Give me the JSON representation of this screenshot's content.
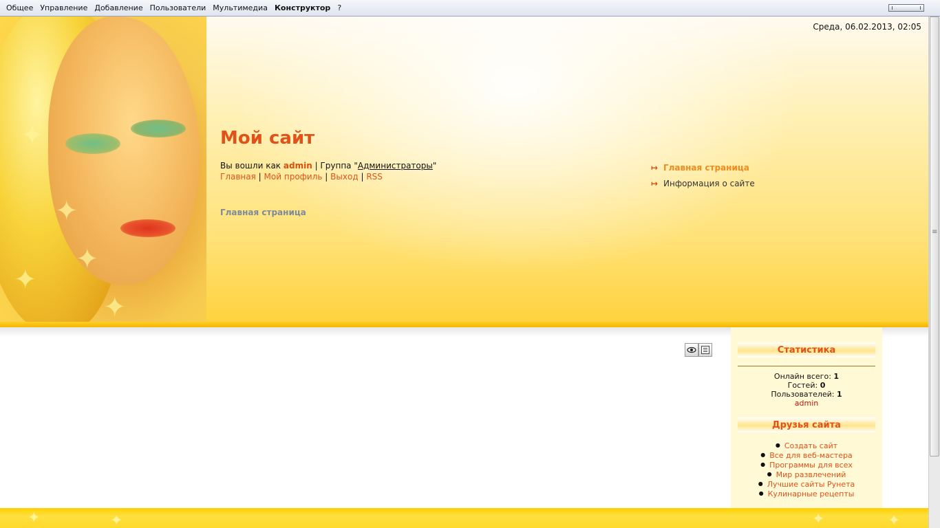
{
  "adminbar": {
    "menu": [
      "Общее",
      "Управление",
      "Добавление",
      "Пользователи",
      "Мультимедиа",
      "Конструктор",
      "?"
    ]
  },
  "header": {
    "datetime": "Среда, 06.02.2013, 02:05",
    "site_title": "Мой сайт",
    "welcome_prefix": "Вы вошли как",
    "username": "admin",
    "group_prefix": "| Группа \"",
    "group_name": "Администраторы",
    "group_suffix": "\"",
    "userlinks": [
      "Главная",
      "Мой профиль",
      "Выход",
      "RSS"
    ],
    "separator": "|",
    "breadcrumb": "Главная страница",
    "nav": [
      {
        "label": "Главная страница",
        "active": true
      },
      {
        "label": "Информация о сайте",
        "active": false
      }
    ],
    "nav_arrow": "↦"
  },
  "tools": {
    "view_icon": "eye-icon",
    "edit_icon": "list-icon"
  },
  "sidebar": {
    "stats_title": "Статистика",
    "online_label": "Онлайн всего:",
    "online_value": "1",
    "guests_label": "Гостей:",
    "guests_value": "0",
    "users_label": "Пользователей:",
    "users_value": "1",
    "online_user": "admin",
    "friends_title": "Друзья сайта",
    "friends": [
      "Создать сайт",
      "Все для веб-мастера",
      "Программы для всех",
      "Мир развлечений",
      "Лучшие сайты Рунета",
      "Кулинарные рецепты"
    ]
  },
  "colors": {
    "accent": "#e0521a",
    "header_yellow": "#ffd23a",
    "sidebar_bg": "#fff9d6"
  }
}
